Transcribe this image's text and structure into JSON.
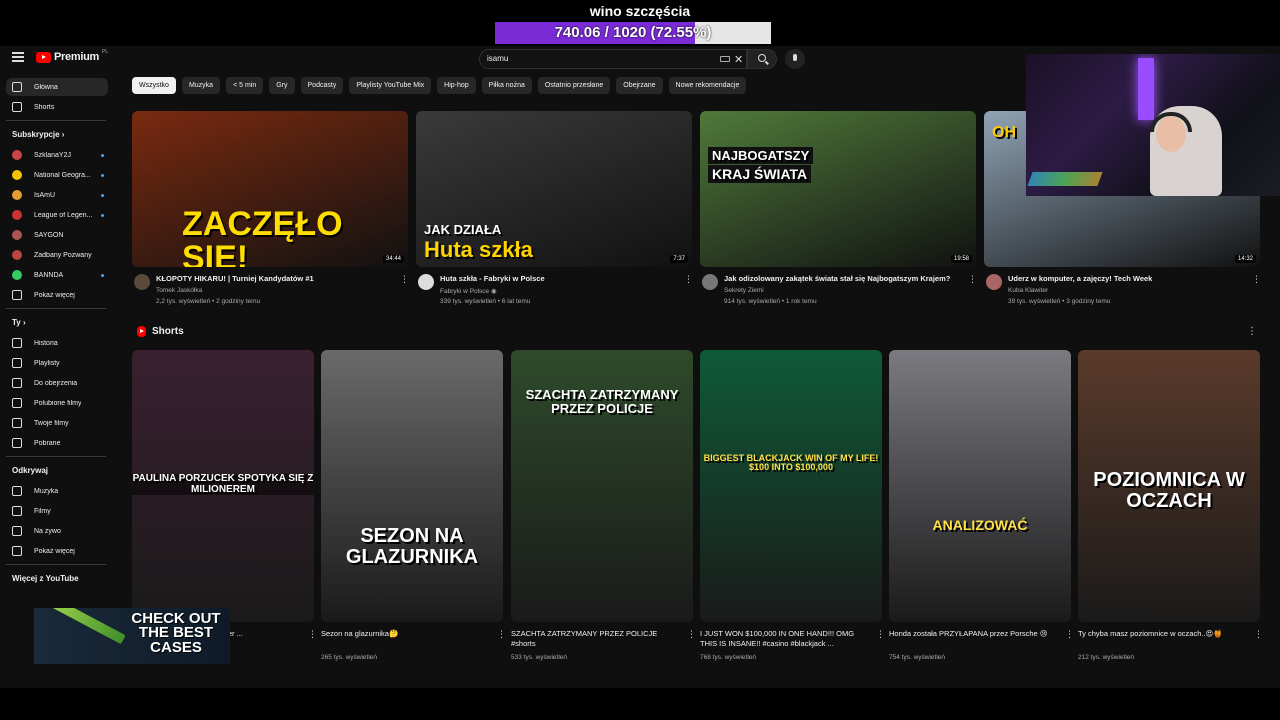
{
  "overlay": {
    "goal_title": "wino szczęścia",
    "goal_text": "740.06 / 1020 (72.55%)",
    "goal_fraction": 0.7255,
    "goal_color": "#7b2bd6"
  },
  "masthead": {
    "logo_text": "Premium",
    "logo_sup": "PL",
    "search_value": "isamu"
  },
  "sidebar": {
    "main": [
      {
        "label": "Główna",
        "icon": "home-icon"
      },
      {
        "label": "Shorts",
        "icon": "shorts-icon"
      }
    ],
    "subs_heading": "Subskrypcje  ›",
    "subs": [
      {
        "label": "SzklanaY2J",
        "color": "#c44"
      },
      {
        "label": "National Geogra...",
        "color": "#f5c400"
      },
      {
        "label": "IsAmU",
        "color": "#e0a030"
      },
      {
        "label": "League of Legen...",
        "color": "#c33"
      },
      {
        "label": "SAYGON",
        "color": "#a55"
      },
      {
        "label": "Zadbany Pozwany",
        "color": "#b44"
      },
      {
        "label": "BANNDA",
        "color": "#3c6"
      }
    ],
    "subs_more": "Pokaż więcej",
    "you_heading": "Ty  ›",
    "you": [
      {
        "label": "Historia",
        "icon": "history-icon"
      },
      {
        "label": "Playlisty",
        "icon": "playlist-icon"
      },
      {
        "label": "Do obejrzenia",
        "icon": "watch-later-icon"
      },
      {
        "label": "Polubione filmy",
        "icon": "like-icon"
      },
      {
        "label": "Twoje filmy",
        "icon": "your-videos-icon"
      },
      {
        "label": "Pobrane",
        "icon": "download-icon"
      }
    ],
    "explore_heading": "Odkrywaj",
    "explore": [
      {
        "label": "Muzyka",
        "icon": "music-icon"
      },
      {
        "label": "Filmy",
        "icon": "film-icon"
      },
      {
        "label": "Na żywo",
        "icon": "live-icon"
      },
      {
        "label": "Pokaż więcej",
        "icon": "chevron-down-icon"
      }
    ],
    "more_heading": "Więcej z YouTube"
  },
  "chips": [
    "Wszystko",
    "Muzyka",
    "< 5 min",
    "Gry",
    "Podcasty",
    "Playlisty YouTube Mix",
    "Hip-hop",
    "Piłka nożna",
    "Ostatnio przesłane",
    "Obejrzane",
    "Nowe rekomendacje"
  ],
  "videos": [
    {
      "title": "KŁOPOTY HIKARU! | Turniej Kandydatów #1",
      "channel": "Tomek Jaskółka",
      "stats": "2,2 tys. wyświetleń • 2 godziny temu",
      "duration": "34:44",
      "thumb_text": "ZACZĘŁO SIĘ!",
      "bg": "#7a2a10",
      "accent": "#ffdd00"
    },
    {
      "title": "Huta szkła - Fabryki w Polsce",
      "channel": "Fabryki w Polsce ◉",
      "stats": "339 tys. wyświetleń • 6 lat temu",
      "duration": "7:37",
      "thumb_small": "JAK DZIAŁA",
      "thumb_text": "Huta szkła",
      "bg": "#3a3a3a",
      "accent": "#ffd400"
    },
    {
      "title": "Jak odizolowany zakątek świata stał się Najbogatszym Krajem?",
      "channel": "Sekrety Ziemi",
      "stats": "914 tys. wyświetleń • 1 rok temu",
      "duration": "19:58",
      "thumb_small": "NAJBOGATSZY",
      "thumb_text": "KRAJ ŚWIATA",
      "bg": "#4f7a3a",
      "accent": "#f1f1f1"
    },
    {
      "title": "Uderz w komputer, a zajęczy! Tech Week",
      "channel": "Kuba Klawiter",
      "stats": "39 tys. wyświetleń • 3 godziny temu",
      "duration": "14:32",
      "thumb_text": "OH",
      "bg": "#8fa3b5",
      "accent": "#ffcc00"
    }
  ],
  "shorts_heading": "Shorts",
  "shorts": [
    {
      "title": "MMA #dzinold emma #milioner ...",
      "stats": "",
      "caption": "PAULINA PORZUCEK SPOTYKA SIĘ Z MILIONEREM",
      "bg": "#3a2030"
    },
    {
      "title": "Sezon na glazurnika🤔",
      "stats": "265 tys. wyświetleń",
      "caption": "SEZON NA GLAZURNIKA",
      "bg": "#6a6a6a"
    },
    {
      "title": "SZACHTA ZATRZYMANY PRZEZ POLICJE #shorts",
      "stats": "533 tys. wyświetleń",
      "caption": "SZACHTA ZATRZYMANY PRZEZ POLICJE",
      "bg": "#2e4a2a"
    },
    {
      "title": "I JUST WON $100,000 IN ONE HAND!!! OMG THIS IS INSANE!! #casino #blackjack ...",
      "stats": "768 tys. wyświetleń",
      "caption": "BIGGEST BLACKJACK WIN OF MY LIFE! $100 INTO $100,000",
      "bg": "#0f5a38"
    },
    {
      "title": "Honda została PRZYŁAPANA przez Porsche 😢",
      "stats": "754 tys. wyświetleń",
      "caption": "ANALIZOWAĆ",
      "bg": "#7a7a80"
    },
    {
      "title": "Ty chyba masz poziomnice w oczach..😍🍯",
      "stats": "212 tys. wyświetleń",
      "caption": "POZIOMNICA W OCZACH",
      "bg": "#5a3a2a"
    }
  ],
  "ad": {
    "text": "CHECK OUT THE BEST CASES"
  }
}
